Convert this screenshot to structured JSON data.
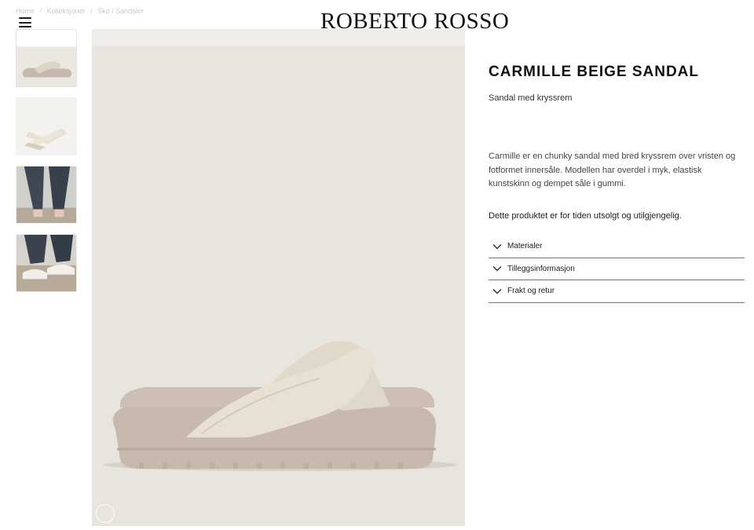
{
  "header": {
    "logo": "ROBERTO ROSSO",
    "breadcrumb": [
      "Home",
      "/",
      "Kolleksjoner",
      "/",
      "Sko / Sandaler"
    ]
  },
  "product": {
    "title": "CARMILLE BEIGE SANDAL",
    "subtitle": "Sandal med kryssrem",
    "description": "Carmille er en chunky sandal med bred kryssrem over vristen og fotformet innersåle. Modellen har overdel i myk, elastisk kunstskinn og dempet såle i gummi.",
    "stock_message": "Dette produktet er for tiden utsolgt og utilgjengelig.",
    "accordion": [
      {
        "label": "Materialer"
      },
      {
        "label": "Tilleggsinformasjon"
      },
      {
        "label": "Frakt og retur"
      }
    ]
  },
  "gallery": {
    "thumbnails": [
      "sandal-side-view",
      "sandal-top-view",
      "model-legs-trousers",
      "model-feet-sandals"
    ],
    "colors": {
      "background": "#e8e4de",
      "sole": "#c7b8ad",
      "strap": "#e3dccd"
    }
  }
}
